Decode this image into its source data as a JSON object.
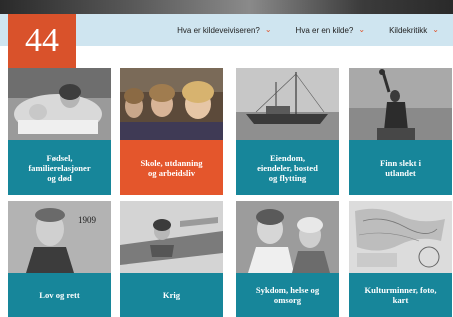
{
  "page_number": "44",
  "nav": {
    "items": [
      {
        "label": "Hva er kildeveiviseren?"
      },
      {
        "label": "Hva er en kilde?"
      },
      {
        "label": "Kildekritikk"
      }
    ]
  },
  "cards": [
    {
      "label_lines": [
        "Fødsel,",
        "familierelasjoner",
        "og død"
      ],
      "photo": "mother-and-baby-photo"
    },
    {
      "label_lines": [
        "Skole, utdanning",
        "og arbeidsliv"
      ],
      "photo": "schoolchildren-photo"
    },
    {
      "label_lines": [
        "Eiendom,",
        "eiendeler, bosted",
        "og flytting"
      ],
      "photo": "ship-photo"
    },
    {
      "label_lines": [
        "Finn slekt i",
        "utlandet"
      ],
      "photo": "statue-of-liberty-photo"
    },
    {
      "label_lines": [
        "Lov og rett"
      ],
      "photo": "prisoner-portrait-photo",
      "photo_text": "1909"
    },
    {
      "label_lines": [
        "Krig"
      ],
      "photo": "pilot-in-aircraft-photo"
    },
    {
      "label_lines": [
        "Sykdom, helse og",
        "omsorg"
      ],
      "photo": "children-photo"
    },
    {
      "label_lines": [
        "Kulturminner, foto,",
        "kart"
      ],
      "photo": "old-map-photo"
    }
  ],
  "colors": {
    "accent_orange": "#e4562c",
    "teal": "#17869a",
    "nav_bg": "#cfe5f0"
  }
}
